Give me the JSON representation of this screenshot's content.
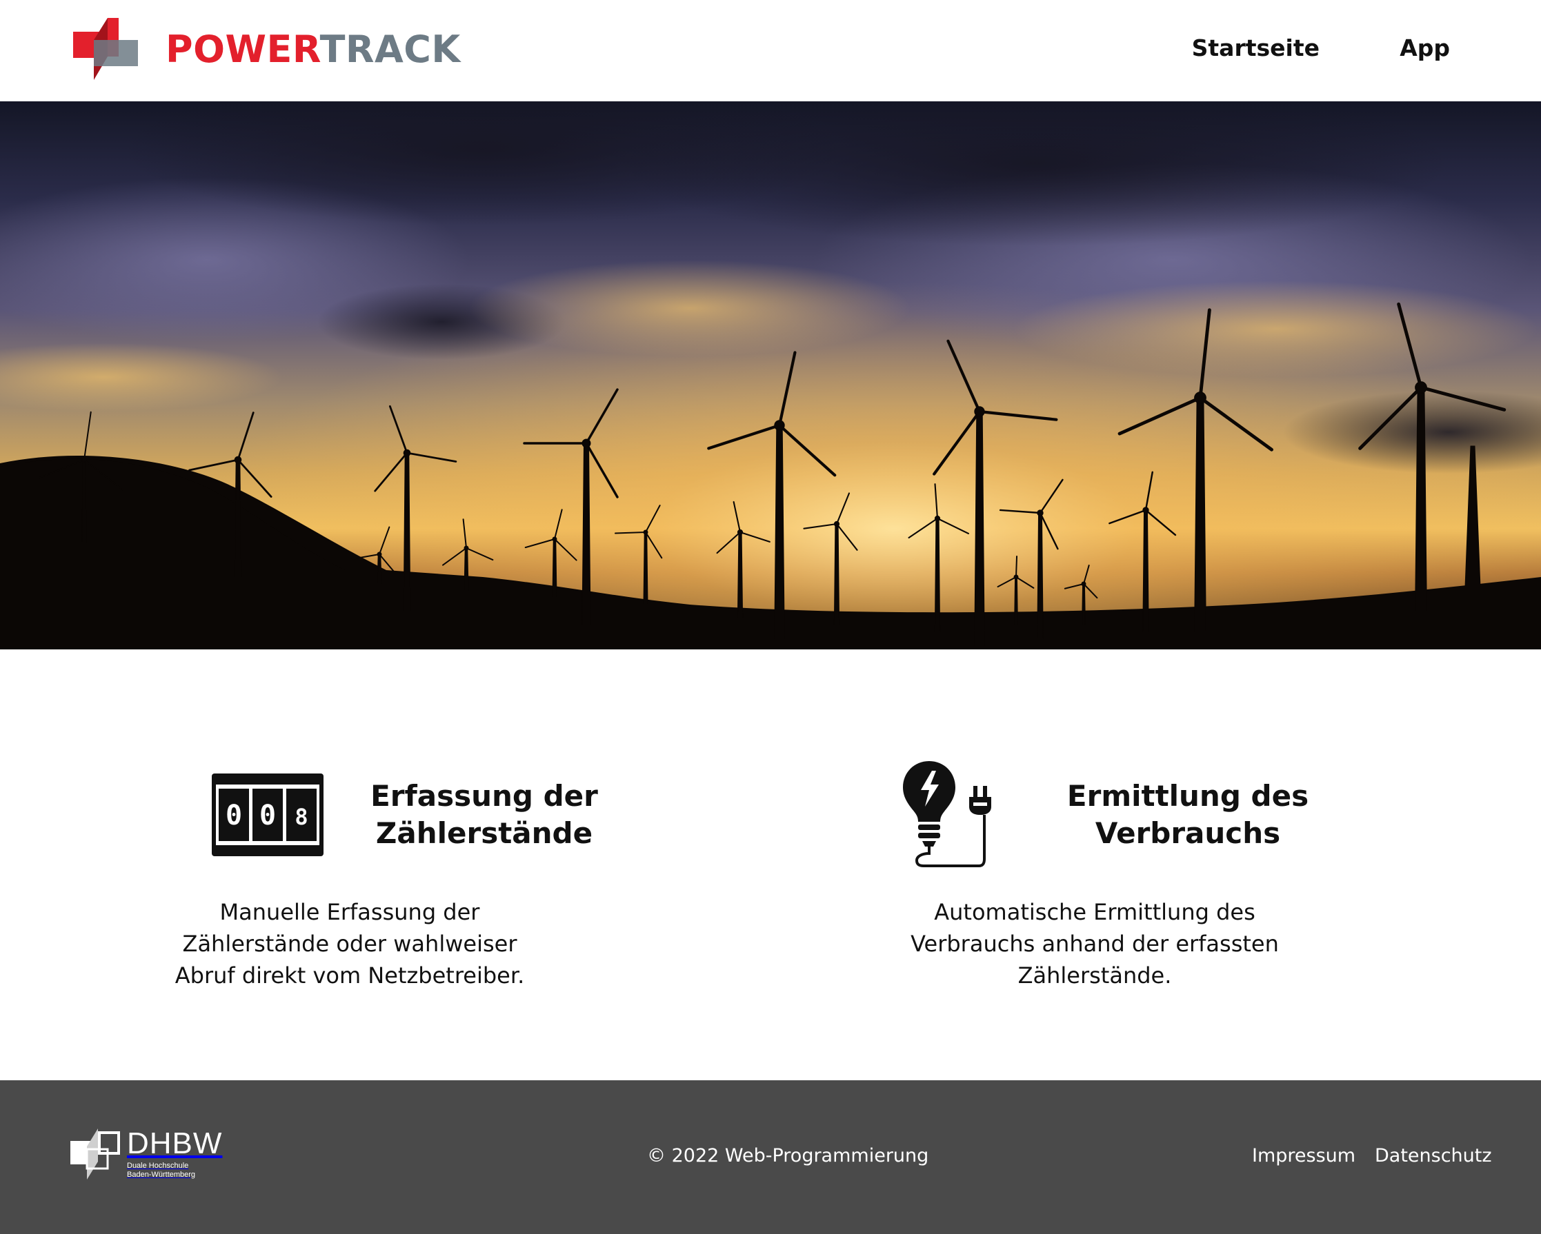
{
  "header": {
    "logo": {
      "part1": "POWER",
      "part2": "TRACK",
      "icon": "powertrack-logo-icon"
    },
    "nav": [
      {
        "label": "Startseite"
      },
      {
        "label": "App"
      }
    ]
  },
  "hero": {
    "image": "wind-turbines-sunset",
    "alt": ""
  },
  "features": [
    {
      "icon": "meter-counter-icon",
      "title_line1": "Erfassung der",
      "title_line2": "Zählerstände",
      "text_line1": "Manuelle Erfassung der",
      "text_line2": "Zählerstände oder wahlweiser",
      "text_line3": "Abruf direkt vom Netzbetreiber.",
      "counter_digits": [
        "0",
        "0",
        "8"
      ]
    },
    {
      "icon": "lightbulb-plug-icon",
      "title_line1": "Ermittlung des",
      "title_line2": "Verbrauchs",
      "text_line1": "Automatische Ermittlung des",
      "text_line2": "Verbrauchs anhand der erfassten",
      "text_line3": "Zählerstände."
    }
  ],
  "footer": {
    "logo": {
      "name": "DHBW",
      "sub_line1": "Duale Hochschule",
      "sub_line2": "Baden-Württemberg"
    },
    "copyright": "© 2022 Web-Programmierung",
    "links": [
      {
        "label": "Impressum"
      },
      {
        "label": "Datenschutz"
      }
    ]
  },
  "colors": {
    "brand_red": "#e3202c",
    "brand_gray": "#6d7b85",
    "footer_bg": "#4a4a4a"
  }
}
